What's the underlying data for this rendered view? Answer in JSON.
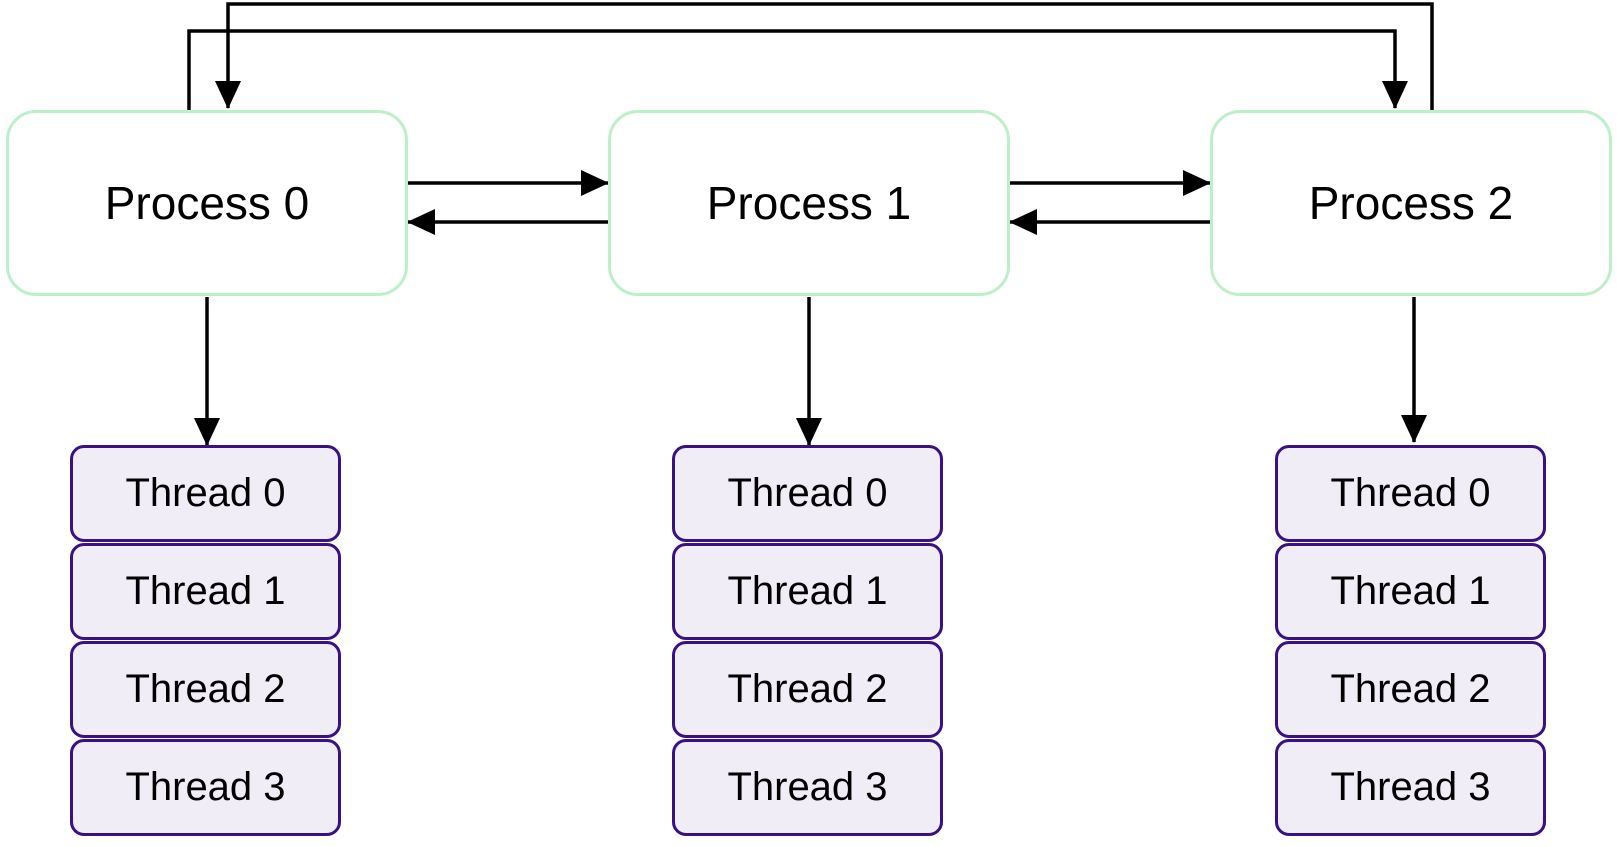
{
  "processes": [
    {
      "label": "Process 0",
      "threads": [
        "Thread 0",
        "Thread 1",
        "Thread 2",
        "Thread 3"
      ]
    },
    {
      "label": "Process 1",
      "threads": [
        "Thread 0",
        "Thread 1",
        "Thread 2",
        "Thread 3"
      ]
    },
    {
      "label": "Process 2",
      "threads": [
        "Thread 0",
        "Thread 1",
        "Thread 2",
        "Thread 3"
      ]
    }
  ],
  "connections": [
    {
      "from": "Process 0",
      "to": "Process 1"
    },
    {
      "from": "Process 1",
      "to": "Process 0"
    },
    {
      "from": "Process 1",
      "to": "Process 2"
    },
    {
      "from": "Process 2",
      "to": "Process 1"
    },
    {
      "from": "Process 0",
      "to": "Process 2"
    },
    {
      "from": "Process 2",
      "to": "Process 0"
    },
    {
      "from": "Process 0",
      "to": "Process 0 threads"
    },
    {
      "from": "Process 1",
      "to": "Process 1 threads"
    },
    {
      "from": "Process 2",
      "to": "Process 2 threads"
    }
  ],
  "colors": {
    "process_border": "#bdf0c9",
    "thread_border": "#3a1183",
    "thread_fill": "#f0edf6",
    "arrow": "#000000"
  }
}
